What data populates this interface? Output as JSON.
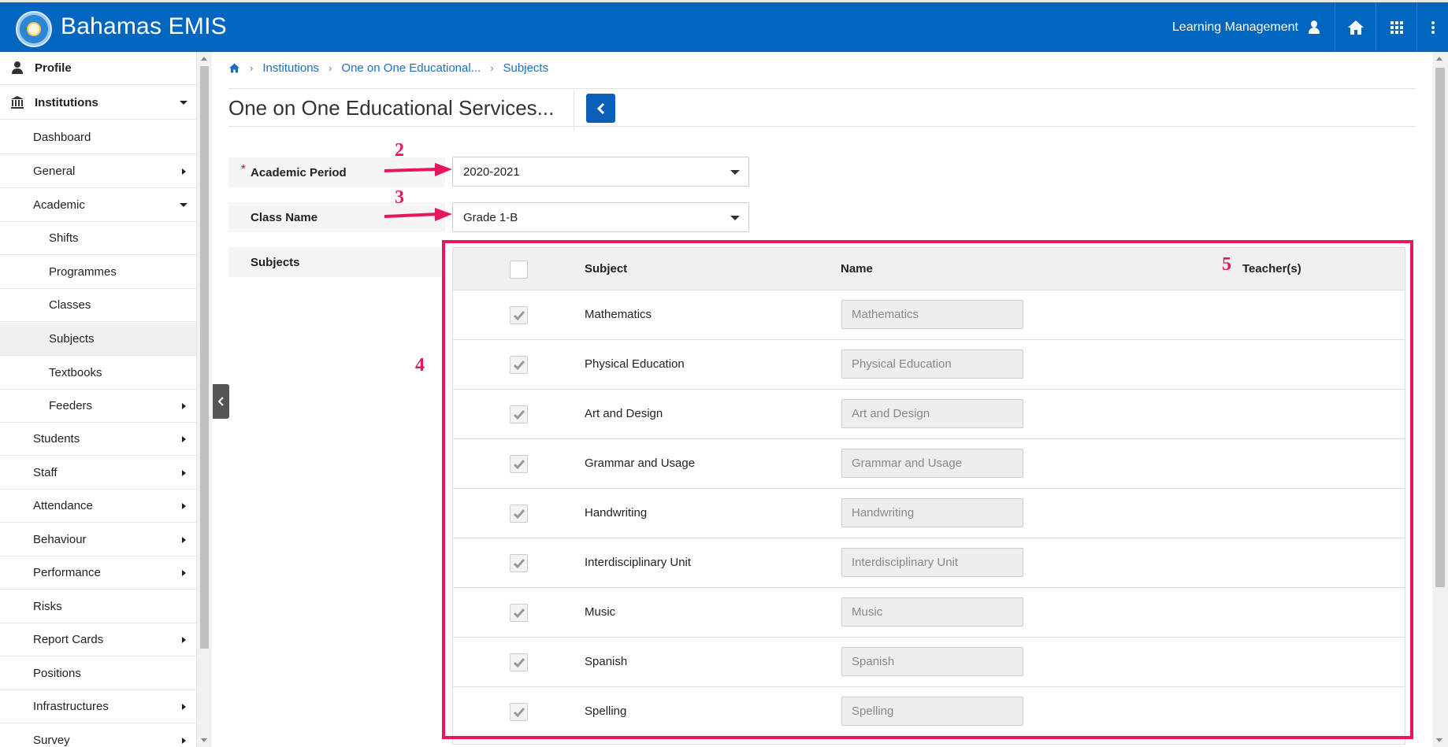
{
  "header": {
    "app_title": "Bahamas EMIS",
    "module_label": "Learning Management",
    "icons": [
      "user-icon",
      "home-icon",
      "apps-grid-icon",
      "more-vertical-icon"
    ]
  },
  "sidebar": {
    "items": [
      {
        "label": "Profile"
      },
      {
        "label": "Institutions"
      },
      {
        "label": "Dashboard"
      },
      {
        "label": "General"
      },
      {
        "label": "Academic"
      },
      {
        "label": "Shifts"
      },
      {
        "label": "Programmes"
      },
      {
        "label": "Classes"
      },
      {
        "label": "Subjects"
      },
      {
        "label": "Textbooks"
      },
      {
        "label": "Feeders"
      },
      {
        "label": "Students"
      },
      {
        "label": "Staff"
      },
      {
        "label": "Attendance"
      },
      {
        "label": "Behaviour"
      },
      {
        "label": "Performance"
      },
      {
        "label": "Risks"
      },
      {
        "label": "Report Cards"
      },
      {
        "label": "Positions"
      },
      {
        "label": "Infrastructures"
      },
      {
        "label": "Survey"
      }
    ]
  },
  "breadcrumb": {
    "items": [
      "Institutions",
      "One on One Educational...",
      "Subjects"
    ]
  },
  "page": {
    "title": "One on One Educational Services..."
  },
  "form": {
    "academic_period_label": "Academic Period",
    "academic_period_value": "2020-2021",
    "class_name_label": "Class Name",
    "class_name_value": "Grade 1-B",
    "subjects_label": "Subjects"
  },
  "table": {
    "headers": {
      "subject": "Subject",
      "name": "Name",
      "teachers": "Teacher(s)"
    },
    "rows": [
      {
        "subject": "Mathematics",
        "name": "Mathematics",
        "checked": true
      },
      {
        "subject": "Physical Education",
        "name": "Physical Education",
        "checked": true
      },
      {
        "subject": "Art and Design",
        "name": "Art and Design",
        "checked": true
      },
      {
        "subject": "Grammar and Usage",
        "name": "Grammar and Usage",
        "checked": true
      },
      {
        "subject": "Handwriting",
        "name": "Handwriting",
        "checked": true
      },
      {
        "subject": "Interdisciplinary Unit",
        "name": "Interdisciplinary Unit",
        "checked": true
      },
      {
        "subject": "Music",
        "name": "Music",
        "checked": true
      },
      {
        "subject": "Spanish",
        "name": "Spanish",
        "checked": true
      },
      {
        "subject": "Spelling",
        "name": "Spelling",
        "checked": true
      }
    ]
  },
  "annotations": {
    "n2": "2",
    "n3": "3",
    "n4": "4",
    "n5": "5"
  },
  "colors": {
    "header_blue": "#0066c0",
    "annotation_pink": "#e8175d",
    "link_blue": "#1a6fc4"
  }
}
